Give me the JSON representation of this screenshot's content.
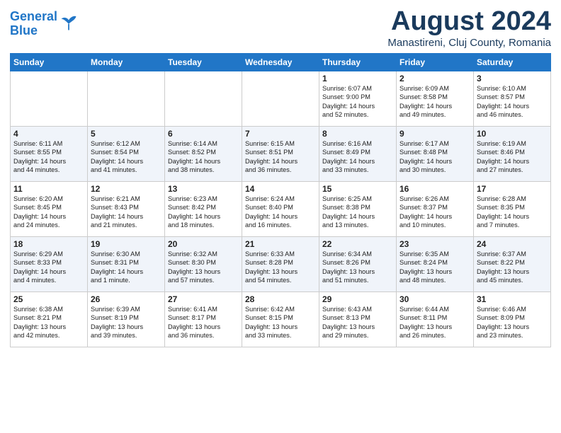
{
  "header": {
    "logo_line1": "General",
    "logo_line2": "Blue",
    "month": "August 2024",
    "location": "Manastireni, Cluj County, Romania"
  },
  "weekdays": [
    "Sunday",
    "Monday",
    "Tuesday",
    "Wednesday",
    "Thursday",
    "Friday",
    "Saturday"
  ],
  "weeks": [
    [
      {
        "day": "",
        "info": ""
      },
      {
        "day": "",
        "info": ""
      },
      {
        "day": "",
        "info": ""
      },
      {
        "day": "",
        "info": ""
      },
      {
        "day": "1",
        "info": "Sunrise: 6:07 AM\nSunset: 9:00 PM\nDaylight: 14 hours\nand 52 minutes."
      },
      {
        "day": "2",
        "info": "Sunrise: 6:09 AM\nSunset: 8:58 PM\nDaylight: 14 hours\nand 49 minutes."
      },
      {
        "day": "3",
        "info": "Sunrise: 6:10 AM\nSunset: 8:57 PM\nDaylight: 14 hours\nand 46 minutes."
      }
    ],
    [
      {
        "day": "4",
        "info": "Sunrise: 6:11 AM\nSunset: 8:55 PM\nDaylight: 14 hours\nand 44 minutes."
      },
      {
        "day": "5",
        "info": "Sunrise: 6:12 AM\nSunset: 8:54 PM\nDaylight: 14 hours\nand 41 minutes."
      },
      {
        "day": "6",
        "info": "Sunrise: 6:14 AM\nSunset: 8:52 PM\nDaylight: 14 hours\nand 38 minutes."
      },
      {
        "day": "7",
        "info": "Sunrise: 6:15 AM\nSunset: 8:51 PM\nDaylight: 14 hours\nand 36 minutes."
      },
      {
        "day": "8",
        "info": "Sunrise: 6:16 AM\nSunset: 8:49 PM\nDaylight: 14 hours\nand 33 minutes."
      },
      {
        "day": "9",
        "info": "Sunrise: 6:17 AM\nSunset: 8:48 PM\nDaylight: 14 hours\nand 30 minutes."
      },
      {
        "day": "10",
        "info": "Sunrise: 6:19 AM\nSunset: 8:46 PM\nDaylight: 14 hours\nand 27 minutes."
      }
    ],
    [
      {
        "day": "11",
        "info": "Sunrise: 6:20 AM\nSunset: 8:45 PM\nDaylight: 14 hours\nand 24 minutes."
      },
      {
        "day": "12",
        "info": "Sunrise: 6:21 AM\nSunset: 8:43 PM\nDaylight: 14 hours\nand 21 minutes."
      },
      {
        "day": "13",
        "info": "Sunrise: 6:23 AM\nSunset: 8:42 PM\nDaylight: 14 hours\nand 18 minutes."
      },
      {
        "day": "14",
        "info": "Sunrise: 6:24 AM\nSunset: 8:40 PM\nDaylight: 14 hours\nand 16 minutes."
      },
      {
        "day": "15",
        "info": "Sunrise: 6:25 AM\nSunset: 8:38 PM\nDaylight: 14 hours\nand 13 minutes."
      },
      {
        "day": "16",
        "info": "Sunrise: 6:26 AM\nSunset: 8:37 PM\nDaylight: 14 hours\nand 10 minutes."
      },
      {
        "day": "17",
        "info": "Sunrise: 6:28 AM\nSunset: 8:35 PM\nDaylight: 14 hours\nand 7 minutes."
      }
    ],
    [
      {
        "day": "18",
        "info": "Sunrise: 6:29 AM\nSunset: 8:33 PM\nDaylight: 14 hours\nand 4 minutes."
      },
      {
        "day": "19",
        "info": "Sunrise: 6:30 AM\nSunset: 8:31 PM\nDaylight: 14 hours\nand 1 minute."
      },
      {
        "day": "20",
        "info": "Sunrise: 6:32 AM\nSunset: 8:30 PM\nDaylight: 13 hours\nand 57 minutes."
      },
      {
        "day": "21",
        "info": "Sunrise: 6:33 AM\nSunset: 8:28 PM\nDaylight: 13 hours\nand 54 minutes."
      },
      {
        "day": "22",
        "info": "Sunrise: 6:34 AM\nSunset: 8:26 PM\nDaylight: 13 hours\nand 51 minutes."
      },
      {
        "day": "23",
        "info": "Sunrise: 6:35 AM\nSunset: 8:24 PM\nDaylight: 13 hours\nand 48 minutes."
      },
      {
        "day": "24",
        "info": "Sunrise: 6:37 AM\nSunset: 8:22 PM\nDaylight: 13 hours\nand 45 minutes."
      }
    ],
    [
      {
        "day": "25",
        "info": "Sunrise: 6:38 AM\nSunset: 8:21 PM\nDaylight: 13 hours\nand 42 minutes."
      },
      {
        "day": "26",
        "info": "Sunrise: 6:39 AM\nSunset: 8:19 PM\nDaylight: 13 hours\nand 39 minutes."
      },
      {
        "day": "27",
        "info": "Sunrise: 6:41 AM\nSunset: 8:17 PM\nDaylight: 13 hours\nand 36 minutes."
      },
      {
        "day": "28",
        "info": "Sunrise: 6:42 AM\nSunset: 8:15 PM\nDaylight: 13 hours\nand 33 minutes."
      },
      {
        "day": "29",
        "info": "Sunrise: 6:43 AM\nSunset: 8:13 PM\nDaylight: 13 hours\nand 29 minutes."
      },
      {
        "day": "30",
        "info": "Sunrise: 6:44 AM\nSunset: 8:11 PM\nDaylight: 13 hours\nand 26 minutes."
      },
      {
        "day": "31",
        "info": "Sunrise: 6:46 AM\nSunset: 8:09 PM\nDaylight: 13 hours\nand 23 minutes."
      }
    ]
  ]
}
